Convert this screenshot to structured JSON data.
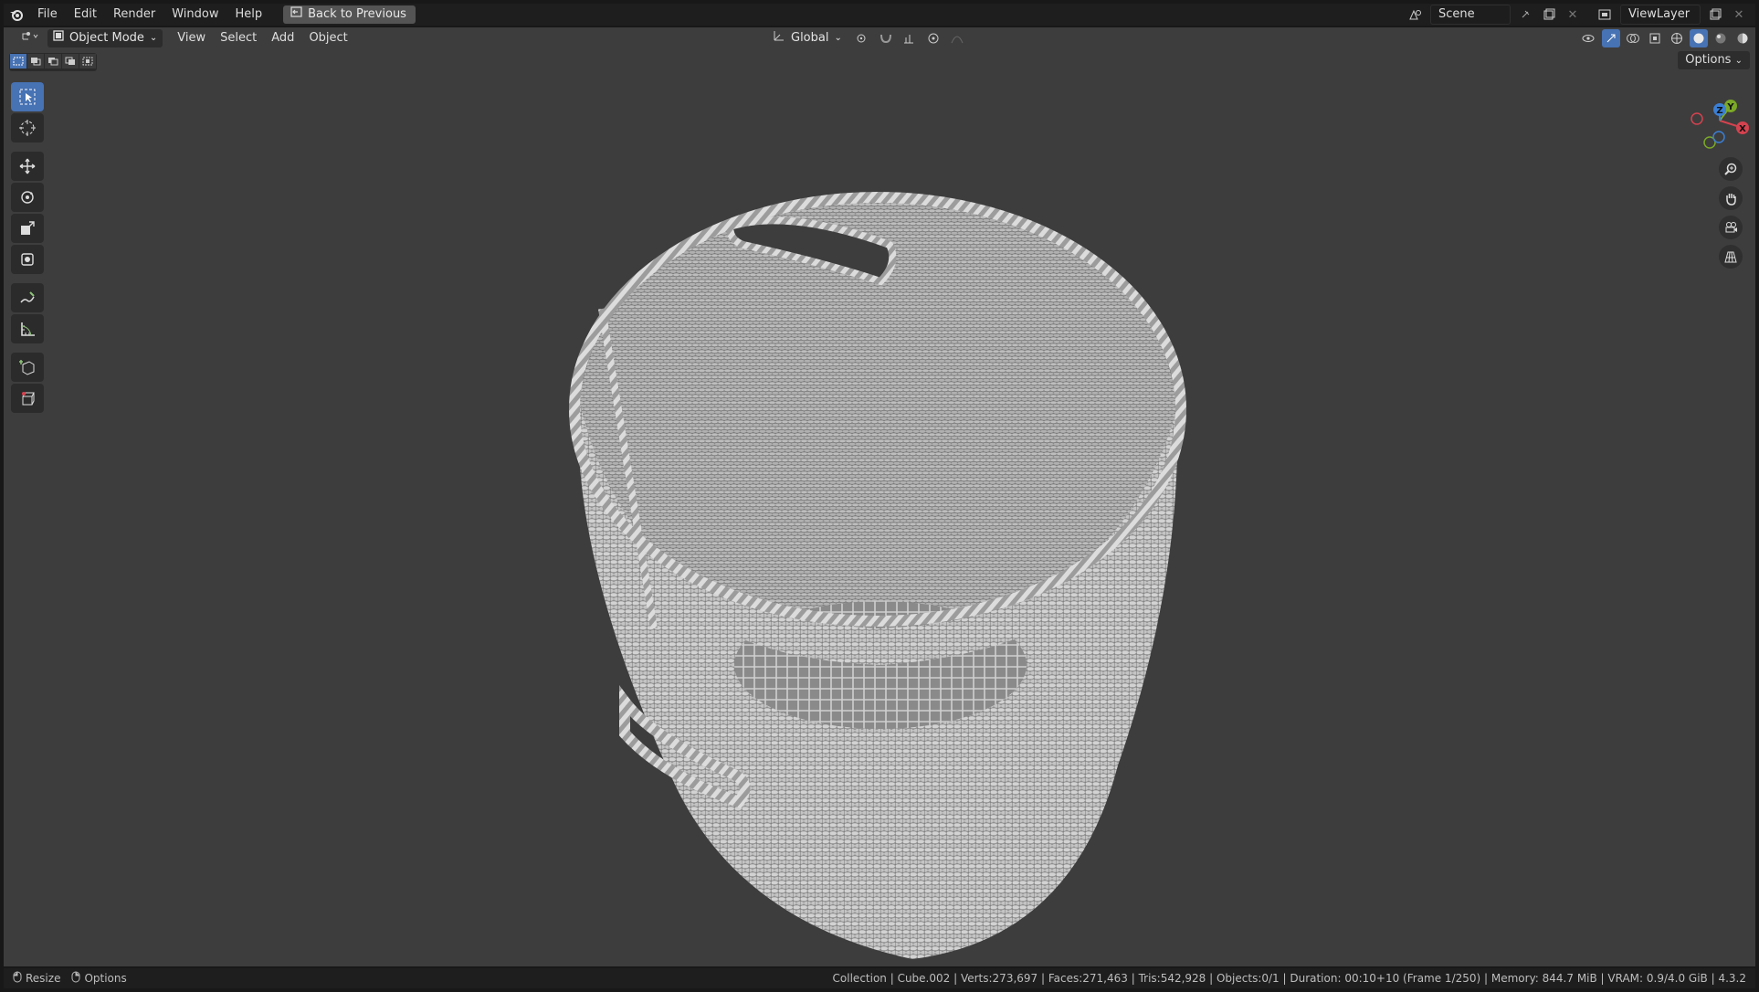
{
  "menu": {
    "items": [
      "File",
      "Edit",
      "Render",
      "Window",
      "Help"
    ],
    "back_button": "Back to Previous"
  },
  "scene": {
    "name": "Scene",
    "view_layer": "ViewLayer"
  },
  "viewport_header": {
    "mode": "Object Mode",
    "menus": [
      "View",
      "Select",
      "Add",
      "Object"
    ],
    "transform_orientation": "Global",
    "options": "Options"
  },
  "gizmo": {
    "x": "X",
    "y": "Y",
    "z": "Z"
  },
  "status": {
    "left_action": "Resize",
    "left_options": "Options",
    "info": "Collection | Cube.002 | Verts:273,697 | Faces:271,463 | Tris:542,928 | Objects:0/1 | Duration: 00:10+10 (Frame 1/250) | Memory: 844.7 MiB | VRAM: 0.9/4.0 GiB | 4.3.2"
  },
  "colors": {
    "accent": "#4772b3",
    "viewport_bg": "#3d3d3d",
    "axis_x": "#d5424f",
    "axis_y": "#7ba827",
    "axis_z": "#3a7fd5"
  },
  "icons": [
    "blender-logo-icon",
    "back-icon",
    "scene-icon",
    "viewlayer-icon",
    "editor-type-icon",
    "object-mode-icon",
    "transform-orientation-icon",
    "pivot-icon",
    "snap-icon",
    "proportional-edit-icon",
    "select-box-icon",
    "cursor-icon",
    "move-icon",
    "rotate-icon",
    "scale-icon",
    "transform-icon",
    "annotate-icon",
    "measure-icon",
    "add-cube-icon",
    "extrude-icon",
    "zoom-icon",
    "pan-hand-icon",
    "camera-icon",
    "ortho-grid-icon"
  ]
}
